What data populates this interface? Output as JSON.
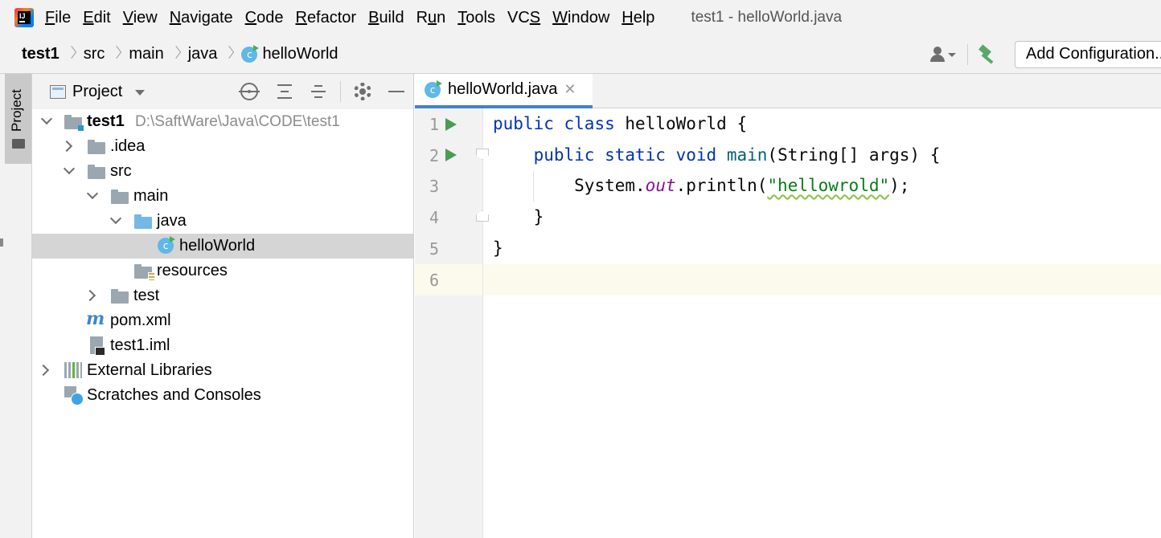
{
  "menu": {
    "items": [
      {
        "u": "F",
        "rest": "ile"
      },
      {
        "u": "E",
        "rest": "dit"
      },
      {
        "u": "V",
        "rest": "iew"
      },
      {
        "u": "N",
        "rest": "avigate"
      },
      {
        "u": "C",
        "rest": "ode"
      },
      {
        "u": "R",
        "rest": "efactor"
      },
      {
        "u": "B",
        "rest": "uild"
      },
      {
        "pre": "R",
        "u": "u",
        "rest": "n"
      },
      {
        "u": "T",
        "rest": "ools"
      },
      {
        "pre": "VC",
        "u": "S",
        "rest": ""
      },
      {
        "u": "W",
        "rest": "indow"
      },
      {
        "u": "H",
        "rest": "elp"
      }
    ],
    "window_title": "test1 - helloWorld.java"
  },
  "breadcrumb": [
    "test1",
    "src",
    "main",
    "java",
    "helloWorld"
  ],
  "toolbar": {
    "add_configuration": "Add Configuration..."
  },
  "tool_strip": {
    "project_tab": "Project"
  },
  "project_panel": {
    "title": "Project",
    "tree": [
      {
        "label": "test1",
        "path": "D:\\SaftWare\\Java\\CODE\\test1"
      },
      {
        "label": ".idea"
      },
      {
        "label": "src"
      },
      {
        "label": "main"
      },
      {
        "label": "java"
      },
      {
        "label": "helloWorld"
      },
      {
        "label": "resources"
      },
      {
        "label": "test"
      },
      {
        "label": "pom.xml"
      },
      {
        "label": "test1.iml"
      },
      {
        "label": "External Libraries"
      },
      {
        "label": "Scratches and Consoles"
      }
    ]
  },
  "editor": {
    "tab_label": "helloWorld.java",
    "line_numbers": [
      "1",
      "2",
      "3",
      "4",
      "5",
      "6"
    ],
    "code": {
      "l1": {
        "kw1": "public",
        "kw2": "class",
        "name": " helloWorld {"
      },
      "l2": {
        "kw1": "public",
        "kw2": "static",
        "kw3": "void",
        "fn": "main",
        "rest": "(String[] args) {"
      },
      "l3": {
        "pre": "System.",
        "field": "out",
        "mid": ".println(",
        "str": "\"hellowrold\"",
        "post": ");"
      },
      "l4": "}",
      "l5": "}"
    }
  },
  "colors": {
    "keyword": "#0033b3",
    "string": "#067d17",
    "field": "#871094",
    "method": "#00627a",
    "selection": "#d5d5d5",
    "tab_underline": "#4083c9",
    "run": "#499c54"
  }
}
